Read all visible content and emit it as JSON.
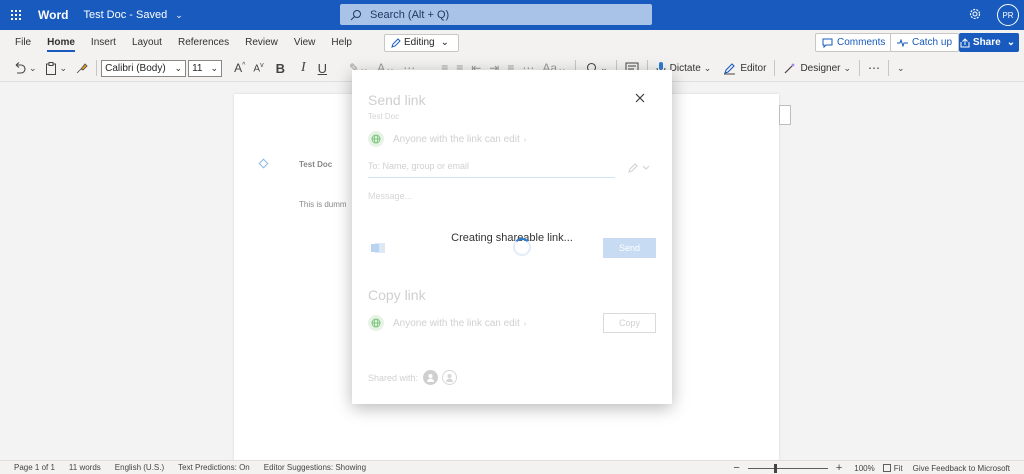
{
  "app": {
    "name": "Word",
    "doc_title": "Test Doc - Saved",
    "search_placeholder": "Search (Alt + Q)",
    "avatar_initials": "PR"
  },
  "ribbon_tabs": [
    "File",
    "Home",
    "Insert",
    "Layout",
    "References",
    "Review",
    "View",
    "Help"
  ],
  "active_tab": "Home",
  "ribbon_actions": {
    "editing_label": "Editing",
    "comments_label": "Comments",
    "catchup_label": "Catch up",
    "share_label": "Share"
  },
  "toolbar": {
    "font_name": "Calibri (Body)",
    "font_size": "11",
    "dictate_label": "Dictate",
    "editor_label": "Editor",
    "designer_label": "Designer"
  },
  "document": {
    "heading": "Test Doc",
    "body": "This is dumm"
  },
  "dialog": {
    "send_title": "Send link",
    "send_subtitle": "Test Doc",
    "permission_text": "Anyone with the link can edit",
    "to_placeholder": "To: Name, group or email",
    "message_placeholder": "Message...",
    "loading_text": "Creating shareable link...",
    "send_label": "Send",
    "copy_title": "Copy link",
    "copy_label": "Copy",
    "shared_with_label": "Shared with:"
  },
  "status_bar": {
    "page": "Page 1 of 1",
    "words": "11 words",
    "language": "English (U.S.)",
    "text_predictions": "Text Predictions: On",
    "editor_suggestions": "Editor Suggestions: Showing",
    "zoom": "100%",
    "fit": "Fit",
    "feedback": "Give Feedback to Microsoft"
  },
  "colors": {
    "brand": "#185abd",
    "accent": "#2b7cd3"
  }
}
